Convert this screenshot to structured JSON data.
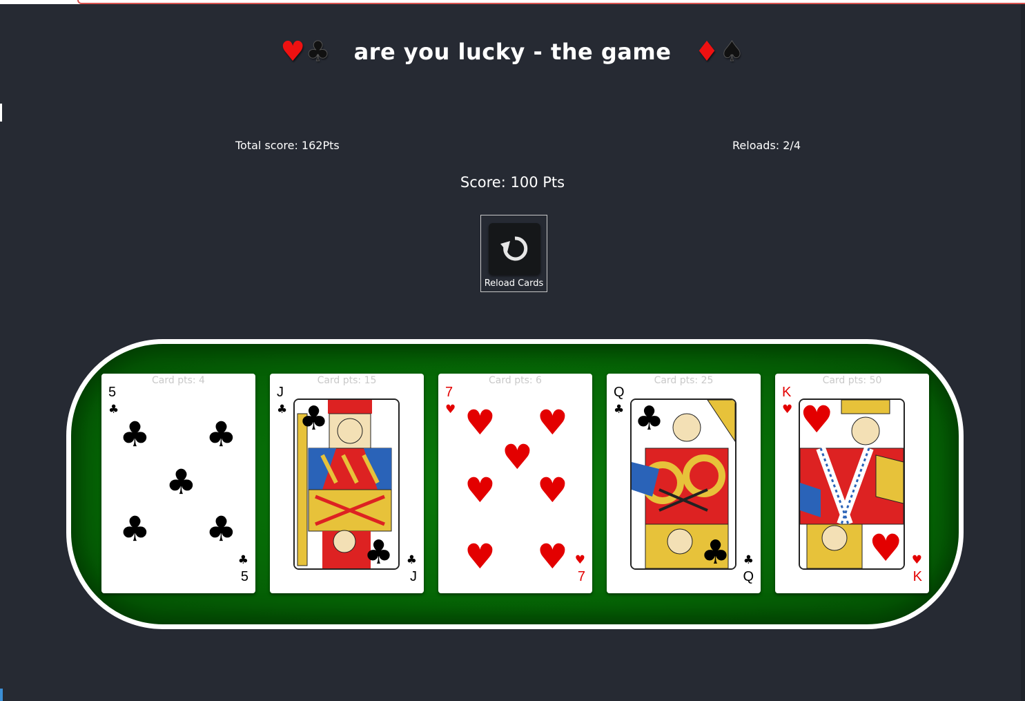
{
  "title": {
    "suits_left": [
      "♥",
      "♣"
    ],
    "text": "are you lucky - the game",
    "suits_right": [
      "♦",
      "♠"
    ]
  },
  "stats": {
    "total_score": "Total score: 162Pts",
    "reloads": "Reloads: 2/4",
    "score": "Score: 100 Pts"
  },
  "reload_button": {
    "label": "Reload Cards",
    "icon": "reload-icon"
  },
  "cards": [
    {
      "pts": "Card pts: 4",
      "rank": "5",
      "suit": "♣",
      "color": "#000000"
    },
    {
      "pts": "Card pts: 15",
      "rank": "J",
      "suit": "♣",
      "color": "#000000"
    },
    {
      "pts": "Card pts: 6",
      "rank": "7",
      "suit": "♥",
      "color": "#e30000"
    },
    {
      "pts": "Card pts: 25",
      "rank": "Q",
      "suit": "♣",
      "color": "#000000"
    },
    {
      "pts": "Card pts: 50",
      "rank": "K",
      "suit": "♥",
      "color": "#e30000"
    }
  ],
  "colors": {
    "background": "#262a33",
    "felt": "#066806",
    "red_suit": "#e30000"
  }
}
